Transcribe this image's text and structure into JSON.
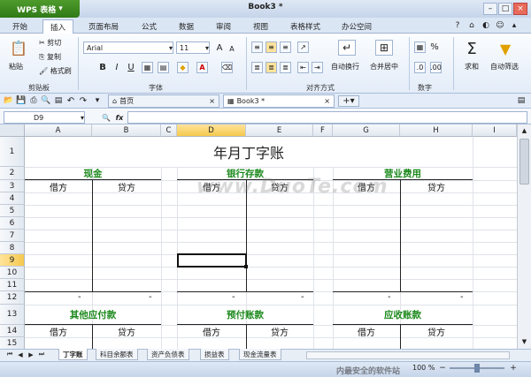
{
  "app": {
    "name": "WPS 表格",
    "document_title": "Book3 *"
  },
  "window_controls": {
    "min": "–",
    "max": "□",
    "close": "×"
  },
  "ribbon_tabs": [
    "开始",
    "插入",
    "页面布局",
    "公式",
    "数据",
    "审阅",
    "视图",
    "表格样式",
    "办公空间"
  ],
  "ribbon": {
    "paste": "粘贴",
    "cut": "剪切",
    "copy": "复制",
    "format_painter": "格式刷",
    "clipboard_group": "剪贴板",
    "font_name": "Arial",
    "font_size": "11",
    "bold": "B",
    "italic": "I",
    "underline": "U",
    "font_group": "字体",
    "align_group": "对齐方式",
    "wrap": "自动换行",
    "merge": "合并居中",
    "number_group": "数字",
    "percent": "%",
    "sum": "求和",
    "autofilter": "自动筛选"
  },
  "doc_tabs": [
    {
      "label": "首页"
    },
    {
      "label": "Book3 *"
    }
  ],
  "formula_bar": {
    "name_box": "D9",
    "fx": "fx",
    "value": ""
  },
  "columns": [
    "A",
    "B",
    "C",
    "D",
    "E",
    "F",
    "G",
    "H",
    "I"
  ],
  "rows": [
    "1",
    "2",
    "3",
    "4",
    "5",
    "6",
    "7",
    "8",
    "9",
    "10",
    "11",
    "12",
    "13",
    "14",
    "15"
  ],
  "selected_cell": "D9",
  "sheet": {
    "title": "年月丁字账",
    "section_headers_top": [
      "现金",
      "银行存款",
      "营业费用"
    ],
    "section_headers_bottom": [
      "其他应付款",
      "预付账款",
      "应收账款"
    ],
    "debit": "借方",
    "credit": "贷方",
    "dash": "-"
  },
  "watermark": "www.DuoTe.com",
  "sheet_tabs": [
    "丁字账",
    "科目余额表",
    "资产负债表",
    "损益表",
    "现金流量表"
  ],
  "status": {
    "zoom": "100 %",
    "corner_watermark": "内最安全的软件站"
  },
  "colors": {
    "accent_green": "#2f7a17",
    "header_text_green": "#1d8a1d",
    "selection_yellow": "#f5c94d"
  }
}
